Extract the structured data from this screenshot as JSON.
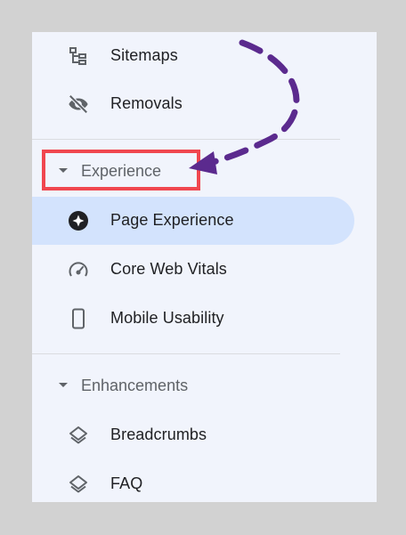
{
  "nav": {
    "items_top": [
      {
        "label": "Sitemaps",
        "icon": "sitemap-icon"
      },
      {
        "label": "Removals",
        "icon": "eye-off-icon"
      }
    ],
    "section_experience": {
      "label": "Experience",
      "icon": "caret-down-icon"
    },
    "items_experience": [
      {
        "label": "Page Experience",
        "icon": "page-experience-icon",
        "active": true
      },
      {
        "label": "Core Web Vitals",
        "icon": "speedometer-icon"
      },
      {
        "label": "Mobile Usability",
        "icon": "smartphone-icon"
      }
    ],
    "section_enhancements": {
      "label": "Enhancements",
      "icon": "caret-down-icon"
    },
    "items_enhancements": [
      {
        "label": "Breadcrumbs",
        "icon": "layers-icon"
      },
      {
        "label": "FAQ",
        "icon": "layers-icon"
      }
    ]
  },
  "annotation": {
    "highlight_color": "#f0474f",
    "arrow_color": "#5b2a8e",
    "active_bg": "#d3e3fd"
  }
}
